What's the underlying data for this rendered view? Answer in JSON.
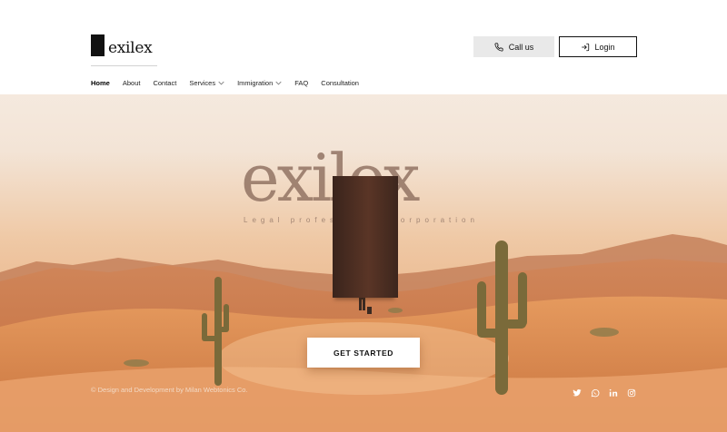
{
  "brand": {
    "logo_text": "exilex"
  },
  "header": {
    "call_label": "Call us",
    "login_label": "Login"
  },
  "nav": {
    "items": [
      {
        "label": "Home",
        "active": true,
        "dropdown": false
      },
      {
        "label": "About",
        "active": false,
        "dropdown": false
      },
      {
        "label": "Contact",
        "active": false,
        "dropdown": false
      },
      {
        "label": "Services",
        "active": false,
        "dropdown": true
      },
      {
        "label": "Immigration",
        "active": false,
        "dropdown": true
      },
      {
        "label": "FAQ",
        "active": false,
        "dropdown": false
      },
      {
        "label": "Consultation",
        "active": false,
        "dropdown": false
      }
    ]
  },
  "hero": {
    "title": "exilex",
    "subtitle": "Legal professional Corporation",
    "cta_label": "GET STARTED"
  },
  "footer": {
    "credit": "© Design and Development by Milan Webtonics Co.",
    "socials": [
      "twitter-icon",
      "whatsapp-icon",
      "linkedin-icon",
      "instagram-icon"
    ]
  },
  "colors": {
    "sand": "#d9864a",
    "sky": "#f4e7dc",
    "accent_dark": "#111111"
  }
}
